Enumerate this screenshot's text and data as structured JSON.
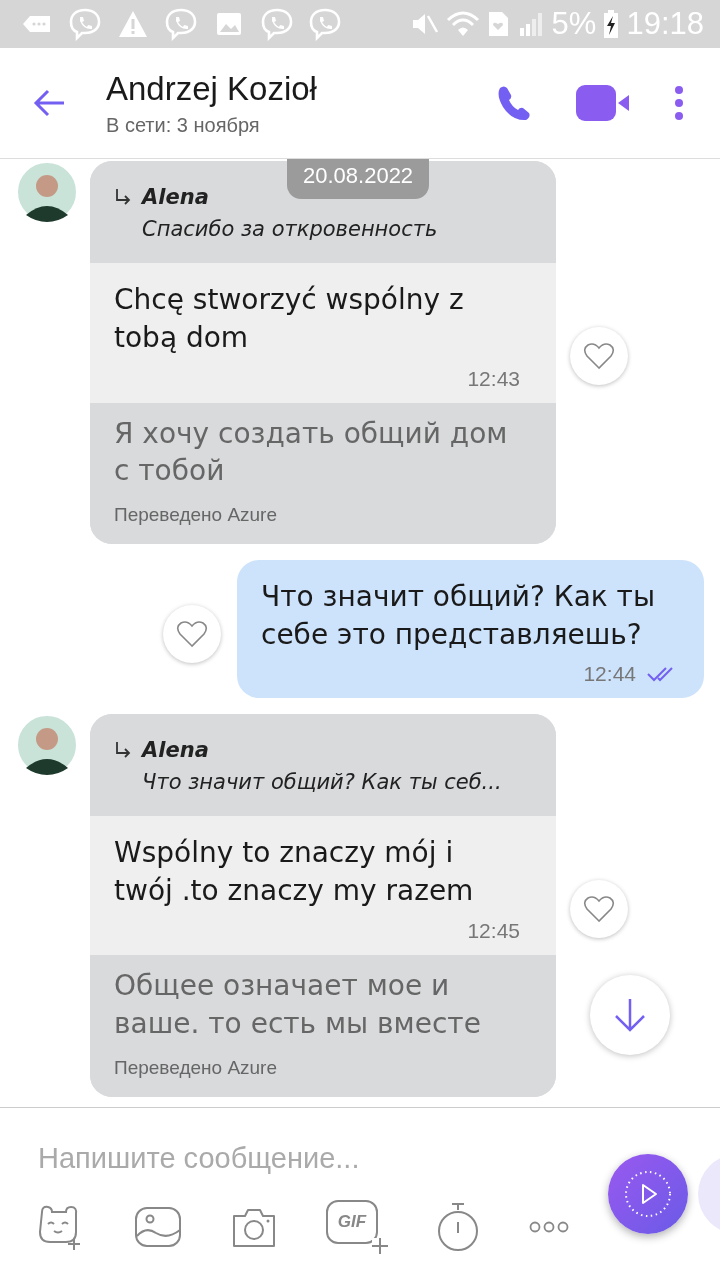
{
  "status_bar": {
    "battery": "5%",
    "time": "19:18"
  },
  "header": {
    "name": "Andrzej Kozioł",
    "status": "В сети: 3 ноября"
  },
  "date_badge": "20.08.2022",
  "messages": [
    {
      "kind": "incoming",
      "reply_author": "Alena",
      "reply_text": "Спасибо за откровенность",
      "text": "Chcę stworzyć wspólny z tobą dom",
      "time": "12:43",
      "translation": "Я хочу создать общий дом с тобой",
      "translation_note": "Переведено Azure",
      "liked": false
    },
    {
      "kind": "outgoing",
      "text": "Что значит общий? Как ты себе это представляешь?",
      "time": "12:44",
      "read": true,
      "liked": false
    },
    {
      "kind": "incoming",
      "reply_author": "Alena",
      "reply_text": "Что значит общий? Как ты себ...",
      "text": "Wspólny to znaczy mój i twój .to znaczy my razem",
      "time": "12:45",
      "translation": "Общее означает мое и ваше. то есть мы вместе",
      "translation_note": "Переведено Azure",
      "liked": false
    }
  ],
  "composer": {
    "placeholder": "Напишите сообщение...",
    "gif_label": "GIF"
  }
}
